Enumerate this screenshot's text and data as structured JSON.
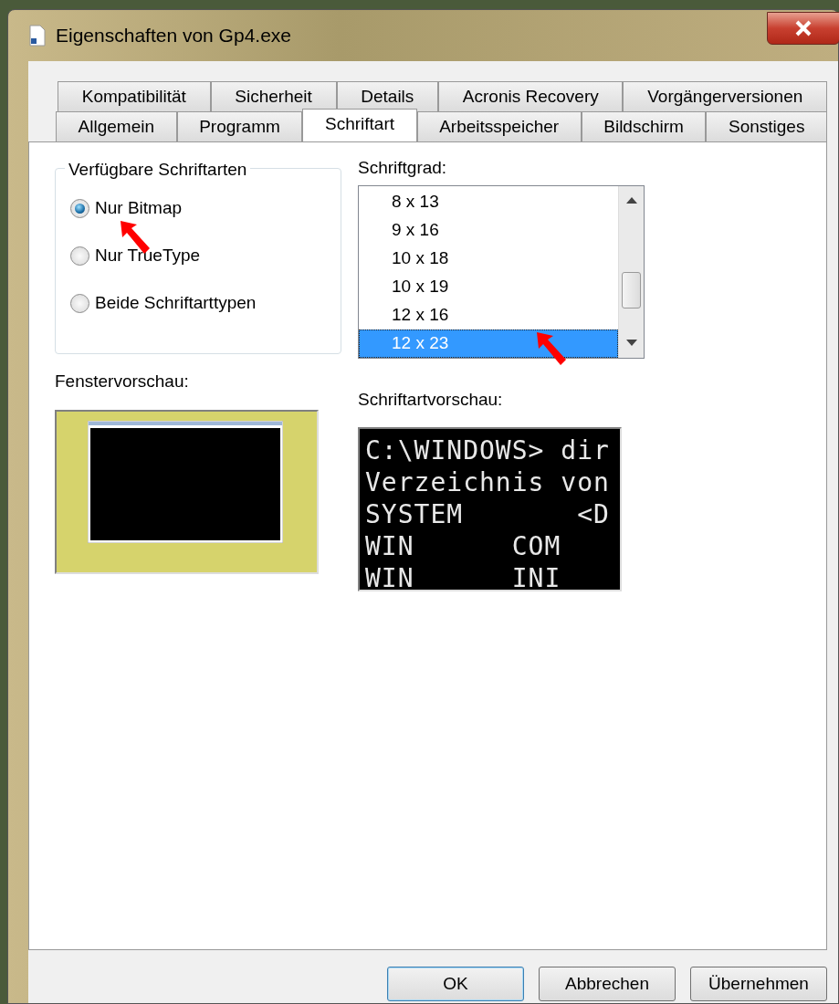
{
  "window": {
    "title": "Eigenschaften von Gp4.exe"
  },
  "tab_rows": [
    [
      {
        "label": "Kompatibilität",
        "selected": false
      },
      {
        "label": "Sicherheit",
        "selected": false
      },
      {
        "label": "Details",
        "selected": false
      },
      {
        "label": "Acronis Recovery",
        "selected": false
      },
      {
        "label": "Vorgängerversionen",
        "selected": false
      }
    ],
    [
      {
        "label": "Allgemein",
        "selected": false
      },
      {
        "label": "Programm",
        "selected": false
      },
      {
        "label": "Schriftart",
        "selected": true
      },
      {
        "label": "Arbeitsspeicher",
        "selected": false
      },
      {
        "label": "Bildschirm",
        "selected": false
      },
      {
        "label": "Sonstiges",
        "selected": false
      }
    ]
  ],
  "font_types": {
    "title": "Verfügbare Schriftarten",
    "options": [
      {
        "label": "Nur Bitmap",
        "selected": true
      },
      {
        "label": "Nur TrueType",
        "selected": false
      },
      {
        "label": "Beide Schriftarttypen",
        "selected": false
      }
    ]
  },
  "font_size": {
    "label": "Schriftgrad:",
    "items": [
      {
        "label": "8 x 13",
        "selected": false
      },
      {
        "label": "9 x 16",
        "selected": false
      },
      {
        "label": "10 x 18",
        "selected": false
      },
      {
        "label": "10 x 19",
        "selected": false
      },
      {
        "label": "12 x 16",
        "selected": false
      },
      {
        "label": "12 x 23",
        "selected": true
      }
    ]
  },
  "window_preview": {
    "label": "Fenstervorschau:"
  },
  "font_preview": {
    "label": "Schriftartvorschau:",
    "lines": [
      "C:\\WINDOWS> dir",
      "Verzeichnis von",
      "SYSTEM       <D",
      "WIN      COM",
      "WIN      INI"
    ]
  },
  "buttons": [
    {
      "label": "OK",
      "default": true
    },
    {
      "label": "Abbrechen",
      "default": false
    },
    {
      "label": "Übernehmen",
      "default": false
    }
  ]
}
